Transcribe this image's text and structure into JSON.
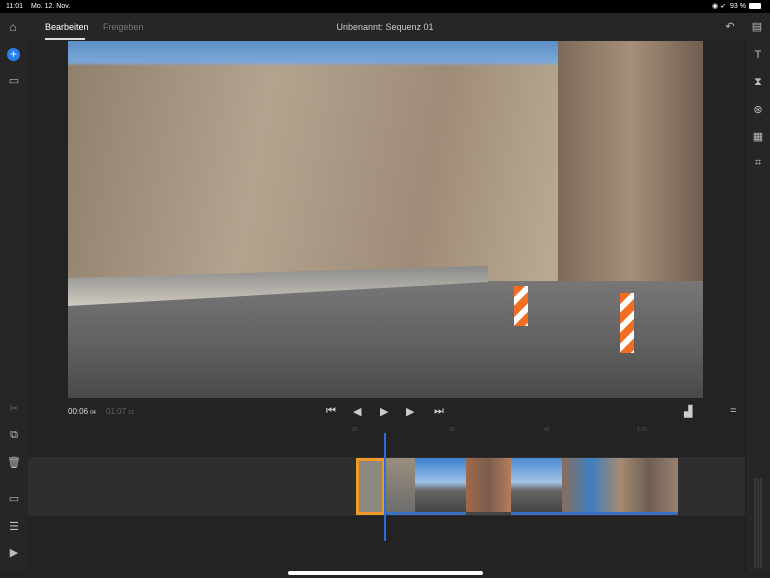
{
  "status": {
    "time": "11:01",
    "date": "Mo. 12. Nov.",
    "battery": "93 %"
  },
  "header": {
    "tabs": [
      "Bearbeiten",
      "Freigeben"
    ],
    "title": "Unbenannt: Sequenz 01"
  },
  "player": {
    "current_time": "00:06",
    "current_frames": "04",
    "duration": "01:07",
    "duration_frames": "13"
  },
  "ruler": [
    "00",
    "20",
    "40",
    "1:00"
  ],
  "colors": {
    "accent": "#2e6be0",
    "selected_clip": "#f09a2a"
  }
}
